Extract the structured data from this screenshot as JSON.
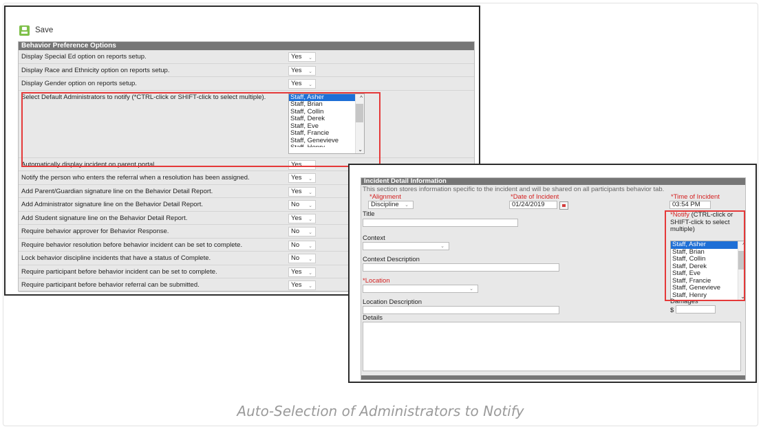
{
  "toolbar": {
    "save_label": "Save",
    "save_icon": "save-icon"
  },
  "preferences": {
    "header": "Behavior Preference Options",
    "rows": [
      {
        "label": "Display Special Ed option on reports setup.",
        "value": "Yes"
      },
      {
        "label": "Display Race and Ethnicity option on reports setup.",
        "value": "Yes"
      },
      {
        "label": "Display Gender option on reports setup.",
        "value": "Yes"
      },
      {
        "label": "Select Default Administrators to notify (*CTRL-click or SHIFT-click to select multiple).",
        "value": ""
      },
      {
        "label": "Automatically display incident on parent portal.",
        "value": "Yes"
      },
      {
        "label": "Notify the person who enters the referral when a resolution has been assigned.",
        "value": "Yes"
      },
      {
        "label": "Add Parent/Guardian signature line on the Behavior Detail Report.",
        "value": "Yes"
      },
      {
        "label": "Add Administrator signature line on the Behavior Detail Report.",
        "value": "No"
      },
      {
        "label": "Add Student signature line on the Behavior Detail Report.",
        "value": "Yes"
      },
      {
        "label": "Require behavior approver for Behavior Response.",
        "value": "No"
      },
      {
        "label": "Require behavior resolution before behavior incident can be set to complete.",
        "value": "No"
      },
      {
        "label": "Lock behavior discipline incidents that have a status of Complete.",
        "value": "No"
      },
      {
        "label": "Require participant before behavior incident can be set to complete.",
        "value": "Yes"
      },
      {
        "label": "Require participant before behavior referral can be submitted.",
        "value": "Yes"
      }
    ],
    "admin_options": [
      "Staff, Asher",
      "Staff, Brian",
      "Staff, Collin",
      "Staff, Derek",
      "Staff, Eve",
      "Staff, Francie",
      "Staff, Genevieve",
      "Staff, Henry"
    ],
    "admin_selected": "Staff, Asher"
  },
  "incident": {
    "header": "Incident Detail Information",
    "description": "This section stores information specific to the incident and will be shared on all participants behavior tab.",
    "alignment_label": "*Alignment",
    "alignment_value": "Discipline",
    "date_label": "*Date of Incident",
    "date_value": "01/24/2019",
    "time_label": "*Time of Incident",
    "time_value": "03:54 PM",
    "title_label": "Title",
    "notify_label_req": "*Notify",
    "notify_label_rest_1": "(CTRL-click or",
    "notify_label_rest_2": "SHIFT-click to select",
    "notify_label_rest_3": "multiple)",
    "notify_options": [
      "Staff, Asher",
      "Staff, Brian",
      "Staff, Collin",
      "Staff, Derek",
      "Staff, Eve",
      "Staff, Francie",
      "Staff, Genevieve",
      "Staff, Henry"
    ],
    "notify_selected": "Staff, Asher",
    "context_label": "Context",
    "context_description_label": "Context Description",
    "location_label": "*Location",
    "location_description_label": "Location Description",
    "damages_label": "Damages",
    "damages_currency": "$",
    "details_label": "Details"
  },
  "caption": "Auto-Selection of Administrators to Notify",
  "colors": {
    "highlight_border": "#e53838",
    "selected_option": "#1e6fd6",
    "panel_header": "#767676",
    "required_text": "#d42020"
  }
}
